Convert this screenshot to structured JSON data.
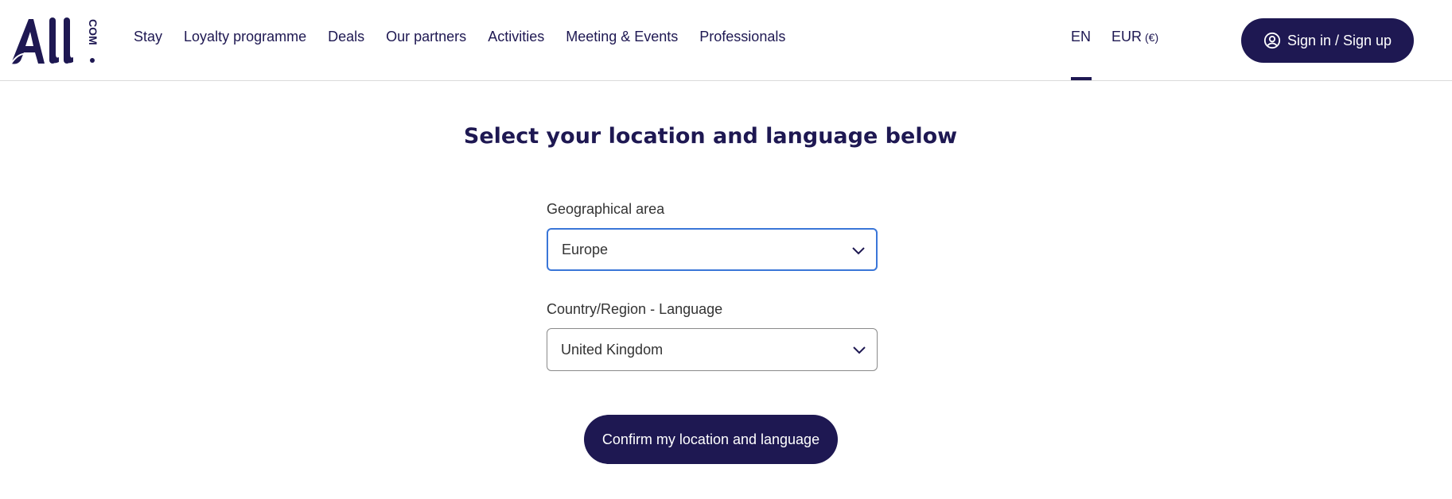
{
  "brand": {
    "logo_text": "All.com",
    "primary_color": "#1e1852",
    "focus_color": "#3a76d8"
  },
  "header": {
    "nav": [
      {
        "label": "Stay"
      },
      {
        "label": "Loyalty programme"
      },
      {
        "label": "Deals"
      },
      {
        "label": "Our partners"
      },
      {
        "label": "Activities"
      },
      {
        "label": "Meeting & Events"
      },
      {
        "label": "Professionals"
      }
    ],
    "language": "EN",
    "currency": "EUR",
    "currency_symbol": "(€)",
    "signin_label": "Sign in / Sign up",
    "signin_icon": "user-circle-icon"
  },
  "main": {
    "title": "Select your location and language below",
    "geo_area": {
      "label": "Geographical area",
      "value": "Europe"
    },
    "country_language": {
      "label": "Country/Region - Language",
      "value": "United Kingdom"
    },
    "confirm_label": "Confirm my location and language"
  }
}
